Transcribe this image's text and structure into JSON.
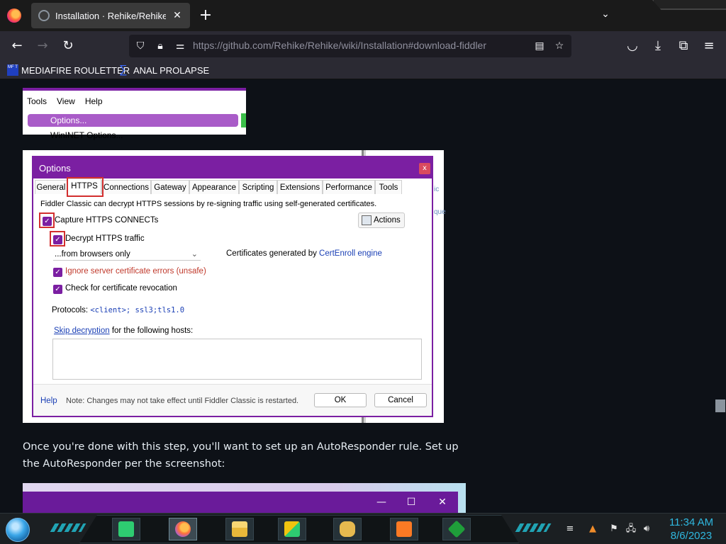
{
  "browser": {
    "tab_title": "Installation · Rehike/Rehike Wiki",
    "tab_close": "✕",
    "new_tab": "+",
    "tab_list": "⌄",
    "url": "https://github.com/Rehike/Rehike/wiki/Installation#download-fiddler",
    "bookmarks": [
      {
        "label": "MEDIAFIRE ROULETTER",
        "icon_text": "MF T"
      },
      {
        "label": "ANAL PROLAPSE",
        "icon_text": "∑"
      }
    ]
  },
  "fiddler_menu": {
    "items": [
      "Tools",
      "View",
      "Help"
    ],
    "highlighted": "Options...",
    "second": "WinINET Options..."
  },
  "options_dialog": {
    "title": "Options",
    "close": "x",
    "tabs": [
      "General",
      "HTTPS",
      "Connections",
      "Gateway",
      "Appearance",
      "Scripting",
      "Extensions",
      "Performance",
      "Tools"
    ],
    "description": "Fiddler Classic can decrypt HTTPS sessions by re-signing traffic using self-generated certificates.",
    "capture_label": "Capture HTTPS CONNECTs",
    "decrypt_label": "Decrypt HTTPS traffic",
    "actions_label": "Actions",
    "dropdown_value": "...from browsers only",
    "cert_prefix": "Certificates generated by ",
    "cert_link": "CertEnroll engine",
    "ignore_label": "Ignore server certificate errors (unsafe)",
    "revocation_label": "Check for certificate revocation",
    "protocols_prefix": "Protocols: ",
    "protocols_value": "<client>; ssl3;tls1.0",
    "skip_link": "Skip decryption",
    "skip_suffix": " for the following hosts:",
    "help": "Help",
    "note": "Note: Changes may not take effect until Fiddler Classic is restarted.",
    "ok": "OK",
    "cancel": "Cancel",
    "checkmark": "✓",
    "side_text": [
      "ic",
      "que"
    ]
  },
  "paragraph": "Once you're done with this step, you'll want to set up an AutoResponder rule. Set up the AutoResponder per the screenshot:",
  "autoresponder": {
    "minimize": "—",
    "maximize": "☐",
    "close": "✕"
  },
  "taskbar": {
    "clock_time": "11:34 AM",
    "clock_date": "8/6/2023",
    "apps": [
      "notes",
      "firefox",
      "file-explorer",
      "move",
      "handshake",
      "xampp",
      "fiddler"
    ]
  }
}
